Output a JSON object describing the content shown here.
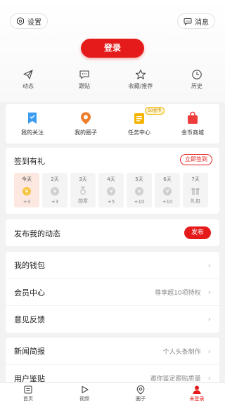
{
  "colors": {
    "accent": "#e51b1b",
    "background": "#f2f2f2"
  },
  "header": {
    "settings": {
      "icon": "settings-hexagon-icon",
      "label": "设置"
    },
    "messages": {
      "icon": "chat-bubble-icon",
      "label": "消息"
    },
    "login_label": "登录"
  },
  "quick": [
    {
      "icon": "paper-plane-icon",
      "label": "动态"
    },
    {
      "icon": "comment-icon",
      "label": "跟贴"
    },
    {
      "icon": "star-icon",
      "label": "收藏/推荐"
    },
    {
      "icon": "clock-icon",
      "label": "历史"
    }
  ],
  "features": [
    {
      "icon": "bookmark-icon",
      "label": "我的关注"
    },
    {
      "icon": "circle-pin-icon",
      "label": "我的圈子"
    },
    {
      "icon": "task-list-icon",
      "label": "任务中心",
      "badge": "50金币"
    },
    {
      "icon": "shopping-bag-icon",
      "label": "金币商城"
    }
  ],
  "signin": {
    "title": "签到有礼",
    "button": "立即签到",
    "days": [
      {
        "day": "今天",
        "reward": "+3",
        "icon": "coin-icon"
      },
      {
        "day": "2天",
        "reward": "+3",
        "icon": "coin-icon"
      },
      {
        "day": "3天",
        "reward": "勋章",
        "icon": "medal-icon"
      },
      {
        "day": "4天",
        "reward": "+5",
        "icon": "coin-icon"
      },
      {
        "day": "5天",
        "reward": "+10",
        "icon": "coin-icon"
      },
      {
        "day": "6天",
        "reward": "+10",
        "icon": "coin-icon"
      },
      {
        "day": "7天",
        "reward": "礼包",
        "icon": "gift-box-icon"
      }
    ]
  },
  "post": {
    "title": "发布我的动态",
    "button": "发布"
  },
  "menu1": [
    {
      "label": "我的钱包",
      "value": ""
    },
    {
      "label": "会员中心",
      "value": "尊享超10项特权"
    },
    {
      "label": "意见反馈",
      "value": ""
    }
  ],
  "menu2": [
    {
      "label": "新闻简报",
      "value": "个人头条制作"
    },
    {
      "label": "用户鉴贴",
      "value": "邀你鉴定跟贴质量"
    }
  ],
  "chevron": "›",
  "tabbar": [
    {
      "icon": "home-icon",
      "label": "首页"
    },
    {
      "icon": "play-icon",
      "label": "视频"
    },
    {
      "icon": "circle-pin-icon",
      "label": "圈子"
    },
    {
      "icon": "user-icon",
      "label": "未登录"
    }
  ]
}
